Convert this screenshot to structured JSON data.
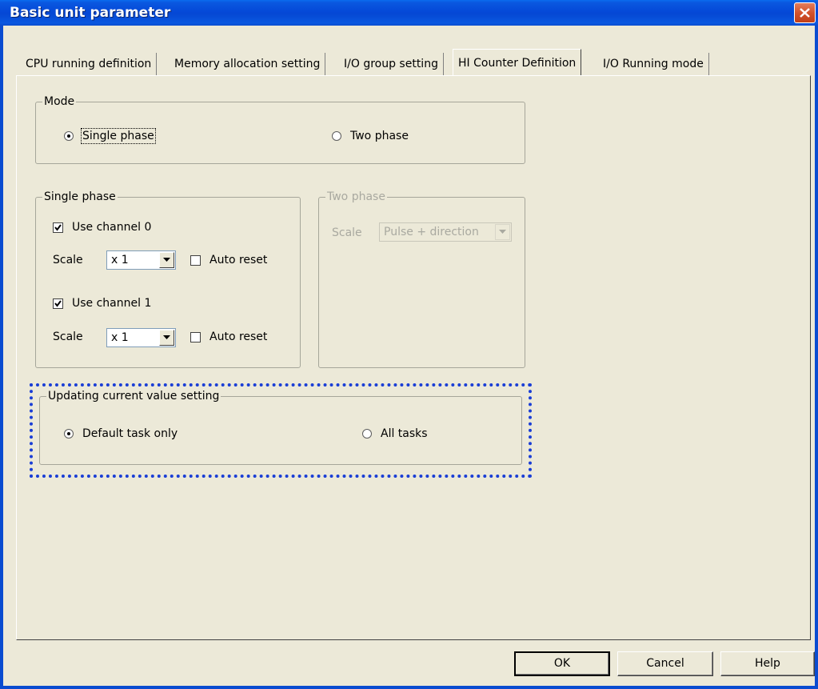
{
  "window": {
    "title": "Basic unit parameter"
  },
  "tabs": [
    {
      "label": "CPU running definition"
    },
    {
      "label": "Memory allocation setting"
    },
    {
      "label": "I/O group setting"
    },
    {
      "label": "HI Counter Definition"
    },
    {
      "label": "I/O Running mode"
    }
  ],
  "mode": {
    "title": "Mode",
    "single_phase": "Single phase",
    "two_phase": "Two phase",
    "selected": "Single phase"
  },
  "single_phase_group": {
    "title": "Single phase",
    "channel0": {
      "label": "Use channel 0",
      "checked": true,
      "scale_label": "Scale",
      "scale_value": "x 1",
      "auto_reset_label": "Auto reset",
      "auto_reset": false
    },
    "channel1": {
      "label": "Use channel 1",
      "checked": true,
      "scale_label": "Scale",
      "scale_value": "x 1",
      "auto_reset_label": "Auto reset",
      "auto_reset": false
    }
  },
  "two_phase_group": {
    "title": "Two phase",
    "scale_label": "Scale",
    "scale_value": "Pulse + direction",
    "enabled": false
  },
  "updating": {
    "title": "Updating current value setting",
    "default_task": "Default task only",
    "all_tasks": "All tasks",
    "selected": "Default task only"
  },
  "buttons": {
    "ok": "OK",
    "cancel": "Cancel",
    "help": "Help"
  },
  "colors": {
    "titlebar": "#0549d8",
    "highlight": "#1a3ed6",
    "face": "#ece9d8"
  }
}
